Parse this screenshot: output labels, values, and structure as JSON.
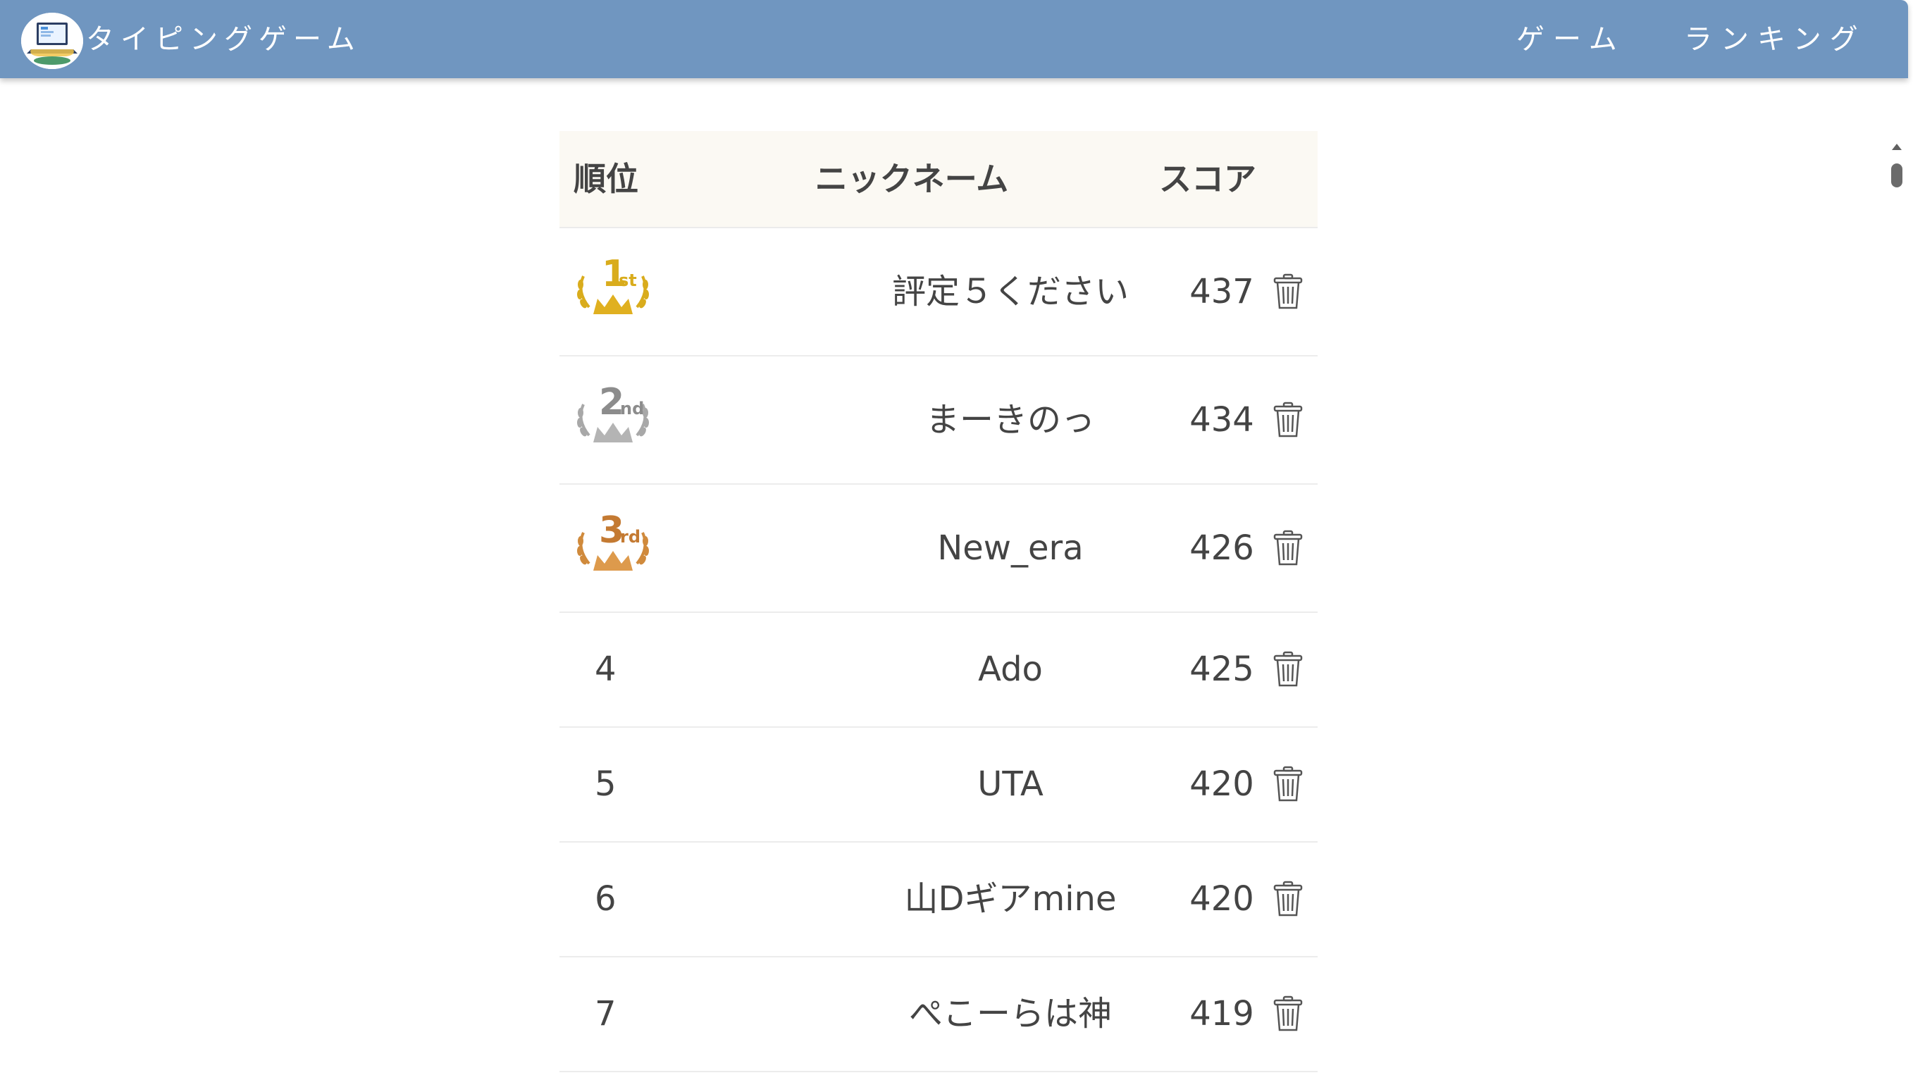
{
  "header": {
    "app_title": "タイピングゲーム",
    "nav": {
      "game": "ゲーム",
      "ranking": "ランキング"
    }
  },
  "table": {
    "columns": {
      "rank": "順位",
      "nickname": "ニックネーム",
      "score": "スコア"
    },
    "rows": [
      {
        "rank": "1",
        "medal": "1st",
        "nickname": "評定５ください",
        "score": "437"
      },
      {
        "rank": "2",
        "medal": "2nd",
        "nickname": "まーきのっ",
        "score": "434"
      },
      {
        "rank": "3",
        "medal": "3rd",
        "nickname": "New_era",
        "score": "426"
      },
      {
        "rank": "4",
        "nickname": "Ado",
        "score": "425"
      },
      {
        "rank": "5",
        "nickname": "UTA",
        "score": "420"
      },
      {
        "rank": "6",
        "nickname": "山Dギアmine",
        "score": "420"
      },
      {
        "rank": "7",
        "nickname": "ぺこーらは神",
        "score": "419"
      }
    ]
  },
  "colors": {
    "header_bg": "#7096c0",
    "gold": "#d9ac1c",
    "silver": "#9a9a9a",
    "bronze": "#c8843a",
    "text": "#444444"
  },
  "icons": {
    "delete": "trash-icon",
    "logo": "laptop-icon"
  }
}
